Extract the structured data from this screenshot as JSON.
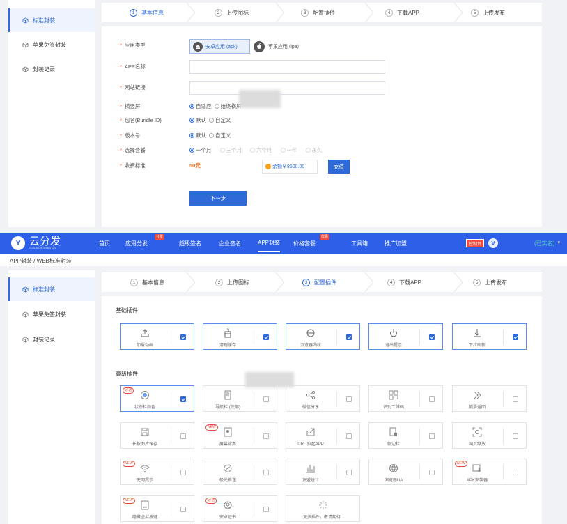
{
  "top_section": {
    "sidebar": [
      {
        "label": "标准封装",
        "icon": "cube-icon",
        "active": true
      },
      {
        "label": "苹果免签封装",
        "icon": "cube-icon",
        "active": false
      },
      {
        "label": "封装记录",
        "icon": "cube-icon",
        "active": false
      }
    ],
    "steps": [
      {
        "num": "1",
        "label": "基本信息"
      },
      {
        "num": "2",
        "label": "上传图标"
      },
      {
        "num": "3",
        "label": "配置插件"
      },
      {
        "num": "4",
        "label": "下载APP"
      },
      {
        "num": "5",
        "label": "上传发布"
      }
    ],
    "form": {
      "app_type_label": "应用类型",
      "app_type_android": "安卓应用 (apk)",
      "app_type_ios": "苹果应用 (ipa)",
      "app_name_label": "APP名称",
      "app_name_value": "",
      "site_link_label": "网站链接",
      "site_link_value": "",
      "orientation_label": "横竖屏",
      "orientation_opt1": "自适应",
      "orientation_opt2": "始终横屏",
      "bundle_label": "包名(Bundle ID)",
      "bundle_opt1": "默认",
      "bundle_opt2": "自定义",
      "version_label": "版本号",
      "version_opt1": "默认",
      "version_opt2": "自定义",
      "package_label": "选择套餐",
      "package_opts": [
        "一个月",
        "三个月",
        "六个月",
        "一年",
        "永久"
      ],
      "fee_label": "收费标准",
      "fee_value": "50元",
      "balance": "余额￥8500.00",
      "recharge": "充值",
      "next": "下一步"
    }
  },
  "header": {
    "logo_text": "云分发",
    "logo_sub": "CLOUD DISTRIBUTION",
    "nav": [
      "首页",
      "应用分发",
      "超级签名",
      "企业签名",
      "APP封装",
      "价格套餐",
      "工具箱",
      "推广加盟"
    ],
    "nav_badge_1": "分发",
    "nav_badge_2": "优惠",
    "console": "控制台",
    "user_initial": "V",
    "user_status": "(已实名)"
  },
  "breadcrumb": "APP封装 / WEB标准封装",
  "bottom_section": {
    "sidebar": [
      {
        "label": "标准封装"
      },
      {
        "label": "苹果免签封装"
      },
      {
        "label": "封装记录"
      }
    ],
    "steps": [
      {
        "num": "1",
        "label": "基本信息"
      },
      {
        "num": "2",
        "label": "上传图标"
      },
      {
        "num": "3",
        "label": "配置插件"
      },
      {
        "num": "4",
        "label": "下载APP"
      },
      {
        "num": "5",
        "label": "上传发布"
      }
    ],
    "basic_title": "基础插件",
    "advanced_title": "高级插件",
    "basic_plugins": [
      {
        "label": "加载动画",
        "icon": "upload-icon",
        "checked": true
      },
      {
        "label": "清理缓存",
        "icon": "broom-icon",
        "checked": true
      },
      {
        "label": "浏览器内核",
        "icon": "browser-icon",
        "checked": true
      },
      {
        "label": "退出提示",
        "icon": "power-icon",
        "checked": true
      },
      {
        "label": "下拉刷新",
        "icon": "pull-down-icon",
        "checked": true
      }
    ],
    "advanced_plugins": [
      {
        "label": "状态栏颜色",
        "icon": "circle-icon",
        "checked": true,
        "tag": "必选"
      },
      {
        "label": "导航栏 (底部)",
        "icon": "phone-icon",
        "checked": false,
        "tag": ""
      },
      {
        "label": "微信分享",
        "icon": "share-icon",
        "checked": false,
        "tag": ""
      },
      {
        "label": "识别二维码",
        "icon": "qrcode-icon",
        "checked": false,
        "tag": ""
      },
      {
        "label": "侧滑返回",
        "icon": "chevrons-right-icon",
        "checked": false,
        "tag": ""
      },
      {
        "label": "长按图片保存",
        "icon": "save-icon",
        "checked": false,
        "tag": ""
      },
      {
        "label": "屏幕常亮",
        "icon": "screen-icon",
        "checked": false,
        "tag": "NEW"
      },
      {
        "label": "URL 拉起APP",
        "icon": "launch-icon",
        "checked": false,
        "tag": ""
      },
      {
        "label": "侧边栏",
        "icon": "sidebar-icon",
        "checked": false,
        "tag": ""
      },
      {
        "label": "网页缩放",
        "icon": "zoom-icon",
        "checked": false,
        "tag": ""
      },
      {
        "label": "无网提示",
        "icon": "wifi-icon",
        "checked": false,
        "tag": "NEW"
      },
      {
        "label": "极光推送",
        "icon": "push-icon",
        "checked": false,
        "tag": ""
      },
      {
        "label": "友盟统计",
        "icon": "stats-icon",
        "checked": false,
        "tag": ""
      },
      {
        "label": "浏览器UA",
        "icon": "globe-icon",
        "checked": false,
        "tag": ""
      },
      {
        "label": "APK安装器",
        "icon": "installer-icon",
        "checked": false,
        "tag": "NEW"
      },
      {
        "label": "隐藏虚拟按键",
        "icon": "keys-icon",
        "checked": false,
        "tag": "NEW"
      },
      {
        "label": "安卓证书",
        "icon": "cert-icon",
        "checked": false,
        "tag": "必选"
      },
      {
        "label": "更多插件，敬请期待...",
        "icon": "sparkle-icon",
        "checked": null,
        "tag": ""
      }
    ]
  }
}
